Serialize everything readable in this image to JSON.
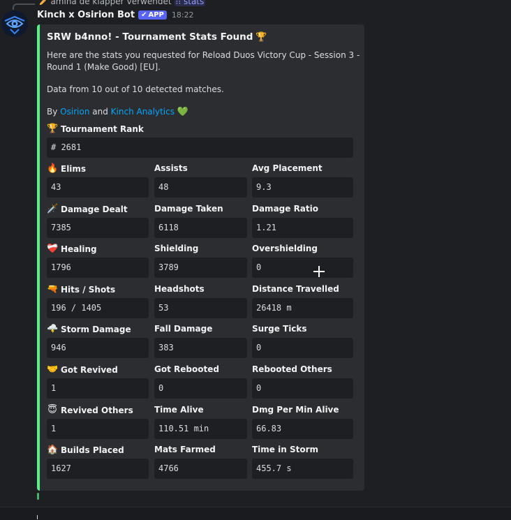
{
  "reply": {
    "user": "amina de klapper",
    "verb": "verwendet",
    "command": "stats"
  },
  "message": {
    "author": "Kinch x Osirion Bot",
    "app_tag": "APP",
    "time": "18:22"
  },
  "embed": {
    "accent_color": "#57f287",
    "title": "SRW b4nno! - Tournament Stats Found",
    "description_1": "Here are the stats you requested for Reload Duos Victory Cup - Session 3 - Round 1 (Make Good) [EU].",
    "description_2": "Data from 10 out of 10 detected matches.",
    "by": "By",
    "link_osirion": "Osirion",
    "and": "and",
    "link_kinch": "Kinch Analytics",
    "rank": {
      "label": "Tournament Rank",
      "value": "# 2681"
    },
    "fields": [
      {
        "label": "Elims",
        "value": "43",
        "icon": "fire-icon"
      },
      {
        "label": "Assists",
        "value": "48"
      },
      {
        "label": "Avg Placement",
        "value": "9.3"
      },
      {
        "label": "Damage Dealt",
        "value": "7385",
        "icon": "dagger-icon"
      },
      {
        "label": "Damage Taken",
        "value": "6118"
      },
      {
        "label": "Damage Ratio",
        "value": "1.21"
      },
      {
        "label": "Healing",
        "value": "1796",
        "icon": "bandaged-heart-icon"
      },
      {
        "label": "Shielding",
        "value": "3789"
      },
      {
        "label": "Overshielding",
        "value": "0"
      },
      {
        "label": "Hits / Shots",
        "value": "196 / 1405",
        "icon": "water-pistol-icon"
      },
      {
        "label": "Headshots",
        "value": "53"
      },
      {
        "label": "Distance Travelled",
        "value": "26418 m"
      },
      {
        "label": "Storm Damage",
        "value": "946",
        "icon": "storm-cloud-icon"
      },
      {
        "label": "Fall Damage",
        "value": "383"
      },
      {
        "label": "Surge Ticks",
        "value": "0"
      },
      {
        "label": "Got Revived",
        "value": "1",
        "icon": "handshake-icon"
      },
      {
        "label": "Got Rebooted",
        "value": "0"
      },
      {
        "label": "Rebooted Others",
        "value": "0"
      },
      {
        "label": "Revived Others",
        "value": "1",
        "icon": "halo-face-icon"
      },
      {
        "label": "Time Alive",
        "value": "110.51 min"
      },
      {
        "label": "Dmg Per Min Alive",
        "value": "66.83"
      },
      {
        "label": "Builds Placed",
        "value": "1627",
        "icon": "house-icon"
      },
      {
        "label": "Mats Farmed",
        "value": "4766"
      },
      {
        "label": "Time in Storm",
        "value": "455.7 s"
      }
    ]
  }
}
